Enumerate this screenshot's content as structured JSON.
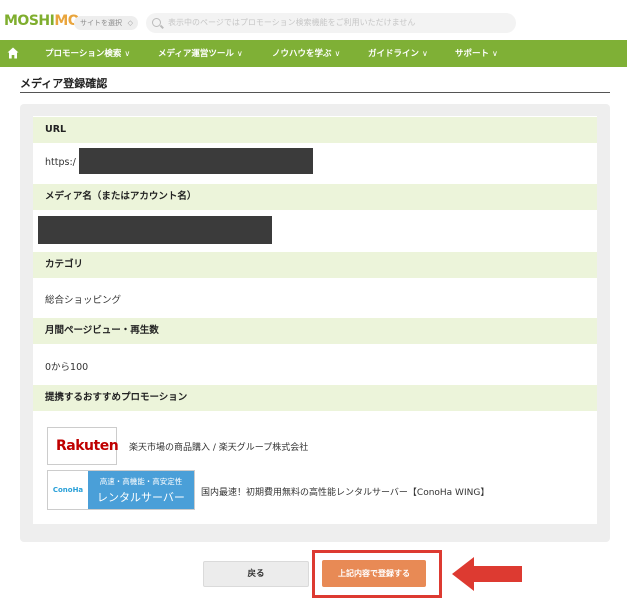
{
  "header": {
    "logo": {
      "a": "MOSH",
      "b": "I",
      "c": "MO"
    },
    "site_select": "サイトを選択",
    "search_placeholder": "表示中のページではプロモーション検索機能をご利用いただけません"
  },
  "nav": {
    "items": [
      {
        "label": "プロモーション検索"
      },
      {
        "label": "メディア運営ツール"
      },
      {
        "label": "ノウハウを学ぶ"
      },
      {
        "label": "ガイドライン"
      },
      {
        "label": "サポート"
      }
    ],
    "caret": "∨"
  },
  "page": {
    "title": "メディア登録確認"
  },
  "form": {
    "url": {
      "label": "URL",
      "value_prefix": "https:/"
    },
    "media_name": {
      "label": "メディア名（またはアカウント名）"
    },
    "category": {
      "label": "カテゴリ",
      "value": "総合ショッピング"
    },
    "pageviews": {
      "label": "月間ページビュー・再生数",
      "value": "0から100"
    },
    "promotions": {
      "label": "提携するおすすめプロモーション",
      "items": [
        {
          "logo_text": "Rakuten",
          "text": "楽天市場の商品購入 / 楽天グループ株式会社"
        },
        {
          "logo_text": "ConoHa",
          "banner_line1": "高速・高機能・高安定性",
          "banner_line2": "レンタルサーバー",
          "text": "国内最速！初期費用無料の高性能レンタルサーバー【ConoHa WING】"
        }
      ]
    }
  },
  "buttons": {
    "back": "戻る",
    "submit": "上記内容で登録する"
  },
  "colors": {
    "nav_green": "#7fb036",
    "label_bg": "#ecf4da",
    "submit": "#e88a55",
    "highlight": "#dd3a31"
  }
}
